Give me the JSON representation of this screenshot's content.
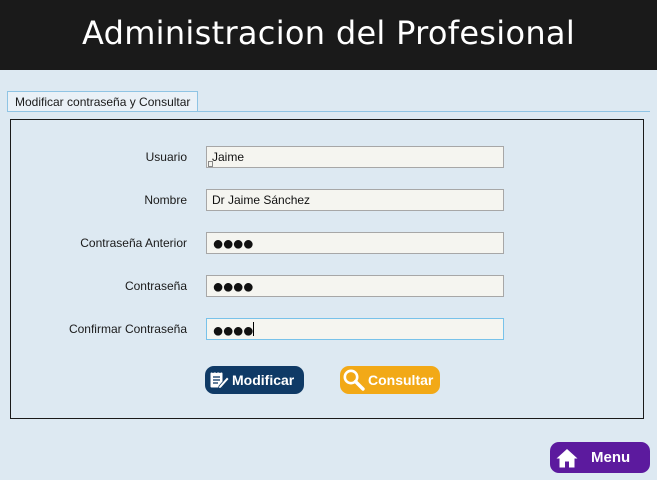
{
  "header": {
    "title": "Administracion del Profesional"
  },
  "tabs": [
    {
      "label": "Modificar contraseña y Consultar",
      "active": true
    }
  ],
  "form": {
    "usuario": {
      "label": "Usuario",
      "value": "Jaime"
    },
    "nombre": {
      "label": "Nombre",
      "value": "Dr Jaime Sánchez"
    },
    "contrasena_anterior": {
      "label": "Contraseña Anterior",
      "value": "●●●●"
    },
    "contrasena": {
      "label": "Contraseña",
      "value": "●●●●"
    },
    "confirmar": {
      "label": "Confirmar Contraseña",
      "value": "●●●●"
    }
  },
  "buttons": {
    "modificar": {
      "label": "Modificar",
      "icon": "notepad-edit-icon",
      "color": "#0f3a66"
    },
    "consultar": {
      "label": "Consultar",
      "icon": "magnifier-icon",
      "color": "#f2a917"
    },
    "menu": {
      "label": "Menu",
      "icon": "home-icon",
      "color": "#5c1a9e"
    }
  },
  "colors": {
    "header_bg": "#1a1a1a",
    "page_bg": "#dde9f2",
    "focus_border": "#78c2ea"
  }
}
